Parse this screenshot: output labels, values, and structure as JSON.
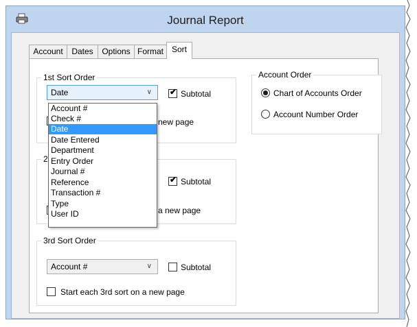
{
  "window": {
    "title": "Journal Report",
    "icon": "printer-app-icon"
  },
  "tabs": [
    {
      "label": "Account",
      "active": false
    },
    {
      "label": "Dates",
      "active": false
    },
    {
      "label": "Options",
      "active": false
    },
    {
      "label": "Format",
      "active": false
    },
    {
      "label": "Sort",
      "active": true
    }
  ],
  "sort1": {
    "legend": "1st Sort Order",
    "value": "Date",
    "subtotal_label": "Subtotal",
    "subtotal_checked": true,
    "newpage_tail": "new page"
  },
  "sort2": {
    "legend_visible": "2",
    "subtotal_label": "Subtotal",
    "subtotal_checked": true,
    "newpage_tail": "a new page"
  },
  "sort3": {
    "legend": "3rd Sort Order",
    "value": "Account #",
    "subtotal_label": "Subtotal",
    "subtotal_checked": false,
    "newpage_label": "Start each 3rd sort on a new page",
    "newpage_checked": false
  },
  "account_order": {
    "legend": "Account Order",
    "options": [
      {
        "label": "Chart of Accounts Order",
        "selected": true
      },
      {
        "label": "Account Number Order",
        "selected": false
      }
    ]
  },
  "dropdown": {
    "items": [
      "Account #",
      "Check #",
      "Date",
      "Date Entered",
      "Department",
      "Entry Order",
      "Journal #",
      "Reference",
      "Transaction #",
      "Type",
      "User ID"
    ],
    "selected": "Date"
  },
  "colors": {
    "titlebar": "#bfd4ee",
    "selection": "#3399ff",
    "focus_border": "#569de5"
  }
}
